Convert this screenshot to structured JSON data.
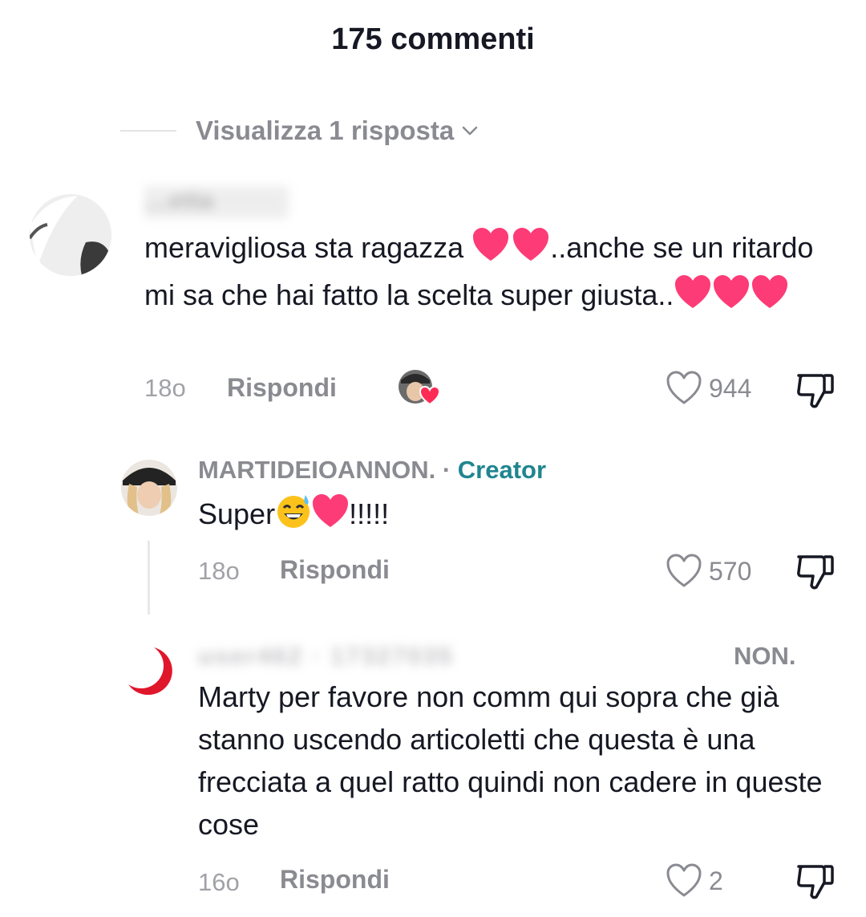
{
  "header": {
    "title": "175 commenti"
  },
  "view_replies": {
    "label": "Visualizza 1 risposta"
  },
  "comments": [
    {
      "username": "…etta",
      "text_part1": "meravigliosa sta ragazza ",
      "text_part2": "..anche se un ritardo mi sa che hai fatto la scelta super giusta..",
      "time": "18o",
      "reply_label": "Rispondi",
      "likes": "944",
      "liked_by_creator": true
    },
    {
      "username": "MARTIDEIOANNON.",
      "badge_sep": " · ",
      "badge": "Creator",
      "text_part1": "Super",
      "text_part2": "!!!!!",
      "time": "18o",
      "reply_label": "Rispondi",
      "likes": "570"
    },
    {
      "username_left": "user462 · 17327035",
      "username_right": "NON.",
      "text": "Marty per favore non comm qui sopra che già stanno uscendo articoletti che questa è una frecciata a quel ratto quindi non cadere in queste cose",
      "time": "16o",
      "reply_label": "Rispondi",
      "likes": "2"
    }
  ],
  "icons": [
    "chevron-down-icon",
    "heart-outline-icon",
    "dislike-icon",
    "pink-heart-emoji",
    "sweat-smile-emoji",
    "creator-liked-avatar"
  ],
  "colors": {
    "text": "#161823",
    "muted": "#8a8b91",
    "creator": "#20858f",
    "heart": "#fe2c55"
  }
}
